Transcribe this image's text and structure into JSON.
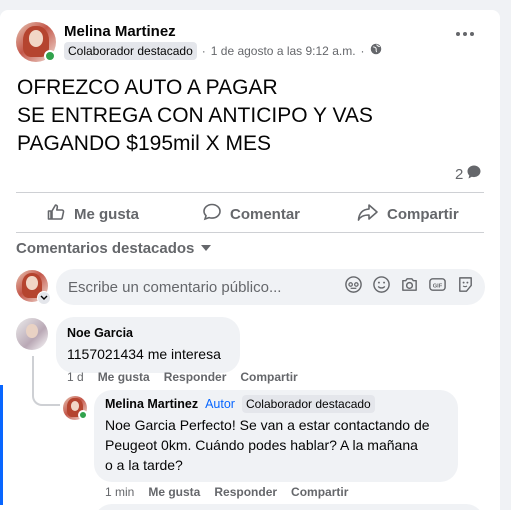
{
  "post": {
    "author": "Melina Martinez",
    "badge": "Colaborador destacado",
    "timestamp": "1 de agosto a las 9:12 a.m.",
    "separator": "·",
    "text": "OFREZCO AUTO A PAGAR\nSE ENTREGA CON ANTICIPO Y VAS\nPAGANDO $195mil X MES",
    "comment_count": "2"
  },
  "actions": {
    "like": "Me gusta",
    "comment": "Comentar",
    "share": "Compartir"
  },
  "comments_filter": {
    "label": "Comentarios destacados"
  },
  "composer": {
    "placeholder": "Escribe un comentario público..."
  },
  "comments": [
    {
      "author": "Noe Garcia",
      "text": "1157021434 me interesa",
      "time": "1 d",
      "like": "Me gusta",
      "reply": "Responder",
      "share": "Compartir"
    }
  ],
  "reply": {
    "author": "Melina Martinez",
    "author_tag": "Autor",
    "badge": "Colaborador destacado",
    "text_line1": "Noe Garcia Perfecto! Se van a estar contactando de",
    "text_line2": "Peugeot 0km. Cuándo podes hablar? A la mañana",
    "text_line3": "o a la tarde?",
    "time": "1 min",
    "like": "Me gusta",
    "reply": "Responder",
    "share": "Compartir"
  },
  "colors": {
    "accent_blue": "#0866ff",
    "online_green": "#31a24c",
    "muted_text": "#65676b",
    "bubble_bg": "#f0f2f5"
  }
}
